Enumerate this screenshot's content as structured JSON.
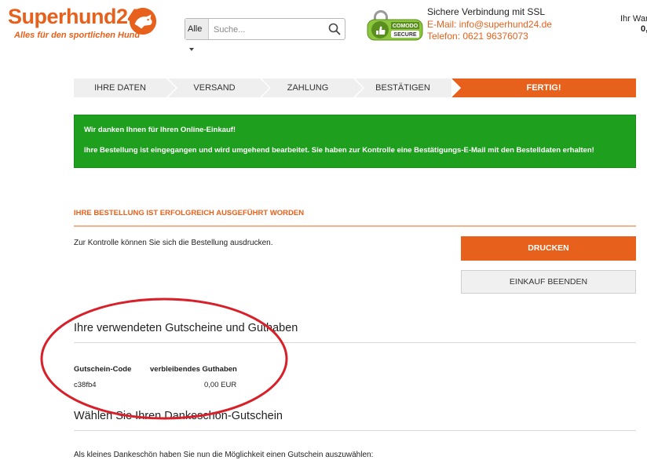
{
  "header": {
    "logo_text": "Superhund24",
    "logo_tagline": "Alles für den sportlichen Hund",
    "search_category": "Alle",
    "search_placeholder": "Suche...",
    "seal_top": "COMODO",
    "seal_bottom": "SECURE",
    "ssl_text": "Sichere Verbindung mit SSL",
    "email": "E-Mail: info@superhund24.de",
    "phone": "Telefon: 0621 96376073",
    "cart_label": "Ihr Waren",
    "cart_amount": "0,"
  },
  "steps": [
    {
      "label": "Ihre Daten",
      "active": false
    },
    {
      "label": "Versand",
      "active": false
    },
    {
      "label": "Zahlung",
      "active": false
    },
    {
      "label": "Bestätigen",
      "active": false
    },
    {
      "label": "Fertig!",
      "active": true
    }
  ],
  "success": {
    "line1": "Wir danken Ihnen für Ihren Online-Einkauf!",
    "line2": "Ihre Bestellung ist eingegangen und wird umgehend bearbeitet. Sie haben zur Kontrolle eine Bestätigungs-E-Mail mit den Bestelldaten erhalten!"
  },
  "order": {
    "title": "Ihre Bestellung ist erfolgreich ausgeführt worden",
    "text": "Zur Kontrolle können Sie sich die Bestellung ausdrucken.",
    "print_label": "DRUCKEN",
    "end_label": "EINKAUF BEENDEN"
  },
  "vouchers": {
    "title": "Ihre verwendeten Gutscheine und Guthaben",
    "col_code": "Gutschein-Code",
    "col_balance": "verbleibendes Guthaben",
    "rows": [
      {
        "code": "c38fb4",
        "balance": "0,00 EUR"
      }
    ]
  },
  "thanks": {
    "title": "Wählen Sie Ihren Dankeschön-Gutschein",
    "text": "Als kleines Dankeschön haben Sie nun die Möglichkeit einen Gutschein auszuwählen:"
  },
  "colors": {
    "brand_orange": "#e8611c",
    "success_green": "#1ea01e",
    "annotation_red": "#d8202a"
  }
}
